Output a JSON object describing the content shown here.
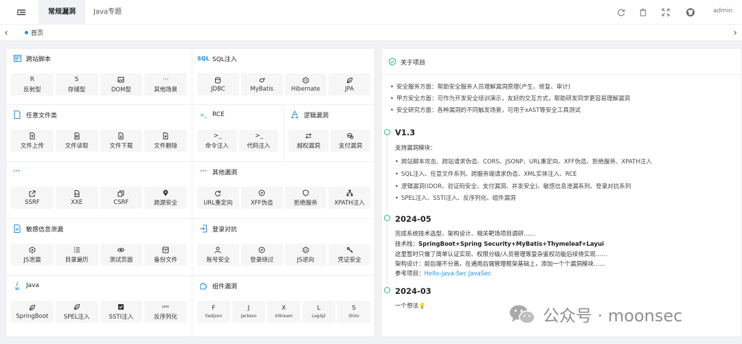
{
  "header": {
    "tabs": [
      {
        "label": "常规漏洞",
        "active": true
      },
      {
        "label": "Java专题",
        "active": false
      }
    ],
    "user": "admin",
    "icons": [
      "refresh-icon",
      "trash-icon",
      "fullscreen-icon",
      "github-icon"
    ]
  },
  "tabstrip": {
    "home_label": "首页"
  },
  "sections": {
    "xss": {
      "title": "跨站脚本",
      "items": [
        {
          "icon": "R",
          "label": "反射型"
        },
        {
          "icon": "S",
          "label": "存储型"
        },
        {
          "icon": "image-icon",
          "label": "DOM型"
        },
        {
          "icon": "···",
          "label": "其他场景"
        }
      ]
    },
    "sqli": {
      "title": "SQL注入",
      "items": [
        {
          "icon": "database-icon",
          "label": "JDBC"
        },
        {
          "icon": "bird-icon",
          "label": "MyBatis"
        },
        {
          "icon": "hex-icon",
          "label": "Hibernate"
        },
        {
          "icon": "leaf-icon",
          "label": "JPA"
        }
      ]
    },
    "file": {
      "title": "任意文件类",
      "items": [
        {
          "icon": "file-icon",
          "label": "文件上传"
        },
        {
          "icon": "file-icon",
          "label": "文件读取"
        },
        {
          "icon": "file-icon",
          "label": "文件下载"
        },
        {
          "icon": "file-icon",
          "label": "文件删除"
        }
      ]
    },
    "rce": {
      "title": "RCE",
      "items": [
        {
          "icon": ">_",
          "label": "命令注入"
        },
        {
          "icon": ">_",
          "label": "代码注入"
        }
      ]
    },
    "logic": {
      "title": "逻辑漏洞",
      "items": [
        {
          "icon": "swap-icon",
          "label": "越权漏洞"
        },
        {
          "icon": "coins-icon",
          "label": "支付漏洞"
        }
      ]
    },
    "ssrf": {
      "title": "···",
      "items": [
        {
          "icon": "external-icon",
          "label": "SSRF"
        },
        {
          "icon": "file-code-icon",
          "label": "XXE"
        },
        {
          "icon": "copy-icon",
          "label": "CSRF"
        },
        {
          "icon": "pin-icon",
          "label": "跨源安全"
        }
      ]
    },
    "other": {
      "title": "其他漏洞",
      "items": [
        {
          "icon": "redo-icon",
          "label": "URL重定向"
        },
        {
          "icon": "compass-icon",
          "label": "XFF伪造"
        },
        {
          "icon": "shield-icon",
          "label": "拒绝服务"
        },
        {
          "icon": "sitemap-icon",
          "label": "XPATH注入"
        }
      ]
    },
    "leak": {
      "title": "敏感信息泄漏",
      "items": [
        {
          "icon": "hex-icon",
          "label": "JS泄漏"
        },
        {
          "icon": "list-icon",
          "label": "目录遍历"
        },
        {
          "icon": "eye-icon",
          "label": "测试页面"
        },
        {
          "icon": "archive-icon",
          "label": "备份文件"
        }
      ]
    },
    "login": {
      "title": "登录对抗",
      "items": [
        {
          "icon": "user-icon",
          "label": "账号安全"
        },
        {
          "icon": "compass-icon",
          "label": "登录绕过"
        },
        {
          "icon": "js-icon",
          "label": "JS逆向"
        },
        {
          "icon": "key-icon",
          "label": "凭证安全"
        }
      ]
    },
    "java": {
      "title": "Java",
      "items": [
        {
          "icon": "leaf-icon",
          "label": "SpringBoot"
        },
        {
          "icon": "leaf-icon",
          "label": "SPEL注入"
        },
        {
          "icon": "check-box-icon",
          "label": "SSTI注入"
        },
        {
          "icon": "json",
          "label": "反序列化"
        }
      ]
    },
    "component": {
      "title": "组件漏洞",
      "items": [
        {
          "icon": "F",
          "label": "Fastjson"
        },
        {
          "icon": "J",
          "label": "Jackson"
        },
        {
          "icon": "X",
          "label": "XStream"
        },
        {
          "icon": "L",
          "label": "Log4j2"
        },
        {
          "icon": "S",
          "label": "Shiro"
        }
      ]
    }
  },
  "about": {
    "title": "关于项目",
    "bullets": [
      "安全服务方面：帮助安全服务人员理解漏洞原理(产生、修复、审计)",
      "甲方安全方面：可作为开发安全培训演示，友好的交互方式，帮助研发同学更容易理解漏洞",
      "安全研究方面：各种漏洞的不同触发场景，可用于xAST等安全工具测试"
    ],
    "timeline": [
      {
        "version": "V1.3",
        "intro": "支持漏洞模块：",
        "bullets": [
          "跨站脚本攻击、跨站请求伪造、CORS、JSONP、URL重定向、XFF伪造、拒绝服务、XPATH注入",
          "SQL注入、任意文件系列、跨服务端请求伪造、XML实体注入、RCE",
          "逻辑漏洞(IDOR、验证码安全、支付漏洞、并发安全)、敏感信息泄漏系列、登录对抗系列",
          "SPEL注入、SSTI注入、反序列化、组件漏洞"
        ]
      },
      {
        "version": "2024-05",
        "line1": "完成系统技术选型、架构设计、相关靶场项目调研……",
        "stack_label": "技术栈：",
        "stack": "SpringBoot+Spring Security+MyBatis+Thymeleaf+Layui",
        "line3": "这里暂时只做了简单认证实现、权限分级/人员管理等复杂鉴权功能后续待实现……",
        "line4": "架构设计：前后端不分离，在通用后端管理框架基础上，添加一个个漏洞模块……",
        "ref_label": "参考项目：",
        "ref_link": "Hello-Java-Sec JavaSec"
      },
      {
        "version": "2024-03",
        "line1": "一个想法💡"
      }
    ]
  },
  "watermark": "公众号 · moonsec"
}
